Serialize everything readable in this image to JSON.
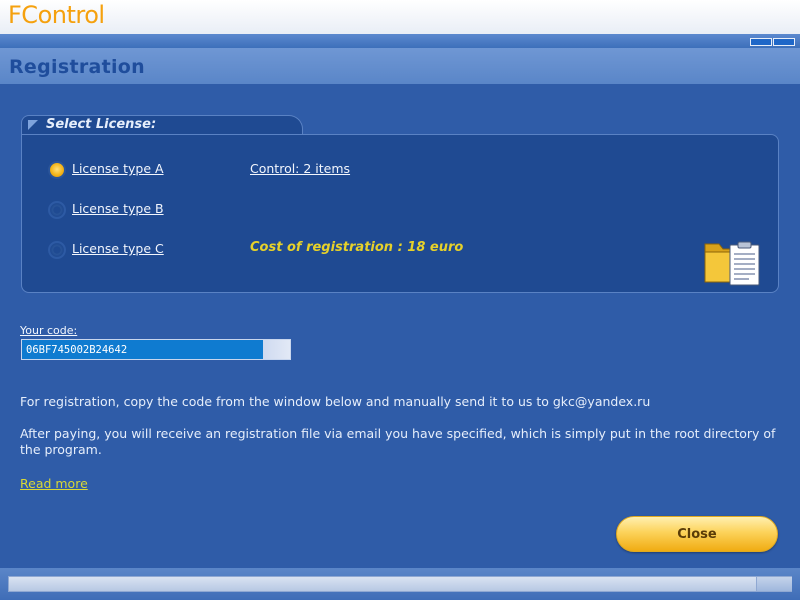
{
  "window": {
    "title": "FControl"
  },
  "page": {
    "title": "Registration"
  },
  "license": {
    "section_label": "Select License:",
    "options": [
      {
        "label": "License type A",
        "selected": true
      },
      {
        "label": "License type B",
        "selected": false
      },
      {
        "label": "License type C",
        "selected": false
      }
    ],
    "control_items": "Control: 2 items",
    "cost": "Cost of registration : 18 euro"
  },
  "code": {
    "label": "Your code:",
    "value": "06BF745002B24642"
  },
  "info": {
    "line1": "For registration, copy the code from the window below and manually send it to us to gkc@yandex.ru",
    "line2": "After paying, you will receive an registration file via email you have specified, which is simply put in the root directory of the program."
  },
  "read_more": "Read more",
  "buttons": {
    "close": "Close"
  },
  "icons": {
    "folder": "folder-document-icon"
  },
  "colors": {
    "accent": "#f5a10e",
    "background": "#2f5ca8",
    "panel": "#1f4a92",
    "cost": "#e6d12a"
  }
}
